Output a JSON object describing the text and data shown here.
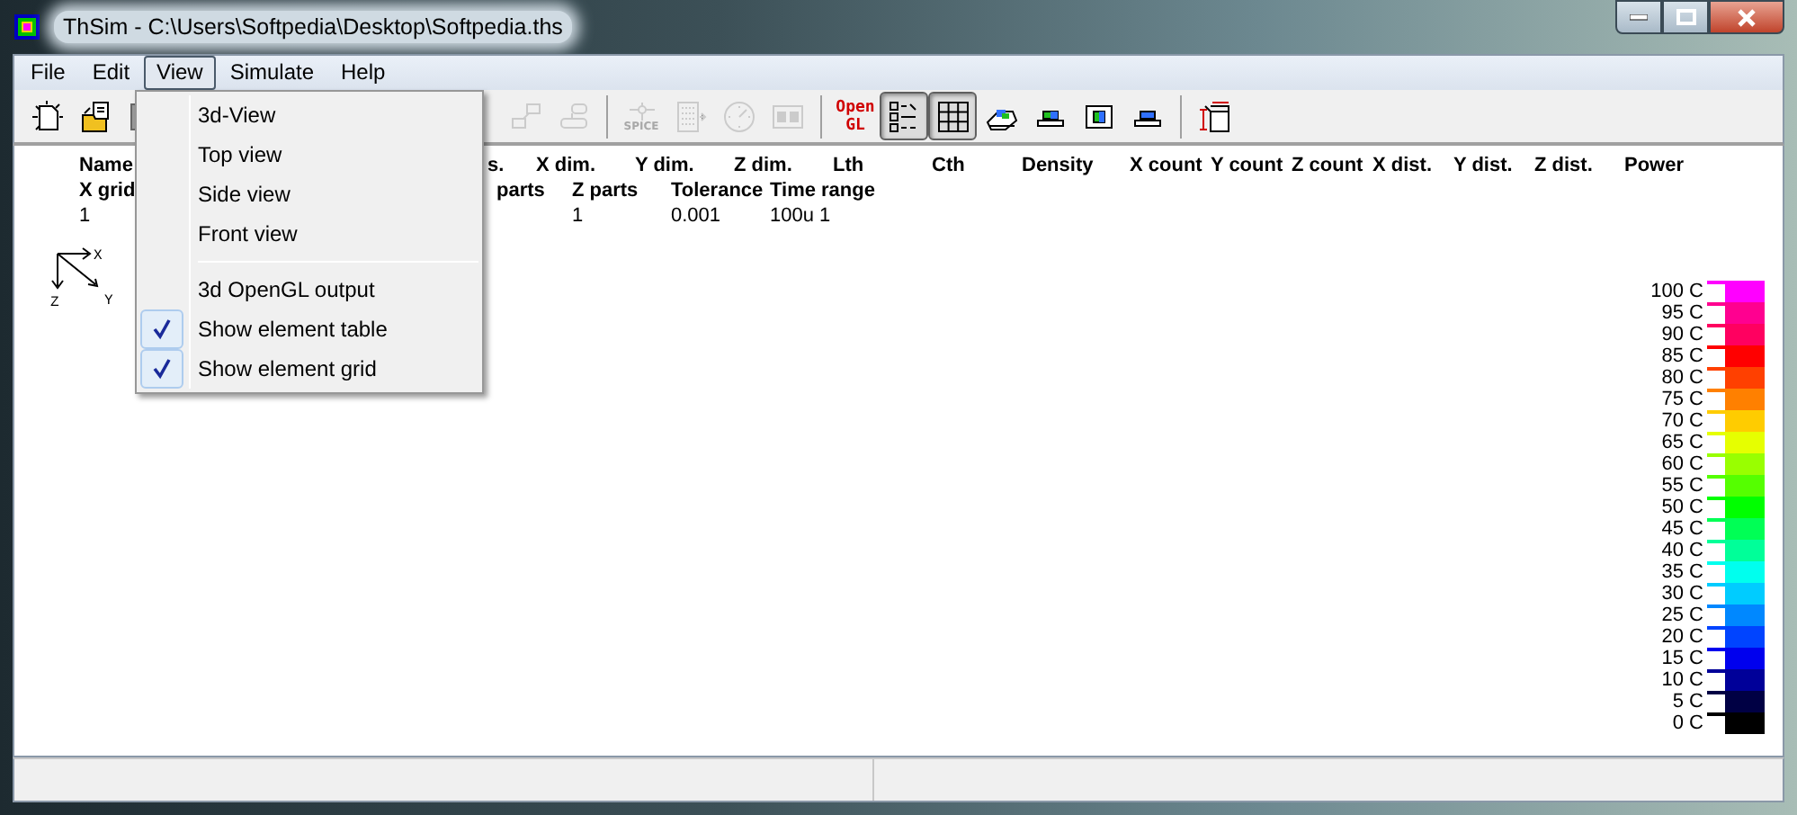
{
  "window": {
    "title": "ThSim - C:\\Users\\Softpedia\\Desktop\\Softpedia.ths"
  },
  "menu_bar": [
    {
      "label": "File",
      "selected": false
    },
    {
      "label": "Edit",
      "selected": false
    },
    {
      "label": "View",
      "selected": true
    },
    {
      "label": "Simulate",
      "selected": false
    },
    {
      "label": "Help",
      "selected": false
    }
  ],
  "toolbar": [
    {
      "kind": "button",
      "pressed": false,
      "disabled": false
    },
    {
      "kind": "button",
      "pressed": false,
      "disabled": false
    },
    {
      "kind": "button",
      "pressed": false,
      "disabled": false
    },
    {
      "kind": "button",
      "pressed": false,
      "disabled": true
    },
    {
      "kind": "button",
      "pressed": false,
      "disabled": true
    },
    {
      "kind": "separator"
    },
    {
      "kind": "button",
      "pressed": false,
      "disabled": true,
      "label": "SPICE"
    },
    {
      "kind": "button",
      "pressed": false,
      "disabled": true
    },
    {
      "kind": "button",
      "pressed": false,
      "disabled": true
    },
    {
      "kind": "button",
      "pressed": false,
      "disabled": true
    },
    {
      "kind": "separator"
    },
    {
      "kind": "text-button",
      "pressed": false,
      "disabled": false,
      "lines": [
        "Open",
        "GL"
      ]
    },
    {
      "kind": "button",
      "pressed": true,
      "disabled": false
    },
    {
      "kind": "button",
      "pressed": true,
      "disabled": false
    },
    {
      "kind": "button",
      "pressed": false,
      "disabled": false
    },
    {
      "kind": "button",
      "pressed": false,
      "disabled": false
    },
    {
      "kind": "button",
      "pressed": false,
      "disabled": false
    },
    {
      "kind": "button",
      "pressed": false,
      "disabled": false
    },
    {
      "kind": "separator"
    },
    {
      "kind": "button",
      "pressed": false,
      "disabled": false
    }
  ],
  "element_table": {
    "rows": [
      {
        "header": true,
        "cells": [
          "Name",
          "s.",
          "X dim.",
          "Y dim.",
          "Z dim.",
          "Lth",
          "Cth",
          "Density",
          "X count",
          "Y count",
          "Z count",
          "X dist.",
          "Y dist.",
          "Z dist.",
          "Power"
        ]
      },
      {
        "header": true,
        "cells": [
          "X grid",
          "parts",
          "Z parts",
          "Tolerance",
          "Time range"
        ]
      },
      {
        "header": false,
        "cells": [
          "1",
          "",
          "1",
          "0.001",
          "100u 1"
        ]
      }
    ]
  },
  "axes": {
    "x": "X",
    "y": "Y",
    "z": "Z"
  },
  "legend": [
    {
      "label": "100 C",
      "color": "#ff00ff"
    },
    {
      "label": "95 C",
      "color": "#ff0090"
    },
    {
      "label": "90 C",
      "color": "#ff0060"
    },
    {
      "label": "85 C",
      "color": "#ff0000"
    },
    {
      "label": "80 C",
      "color": "#ff4000"
    },
    {
      "label": "75 C",
      "color": "#ff8000"
    },
    {
      "label": "70 C",
      "color": "#ffcc00"
    },
    {
      "label": "65 C",
      "color": "#e6ff00"
    },
    {
      "label": "60 C",
      "color": "#99ff00"
    },
    {
      "label": "55 C",
      "color": "#55ff00"
    },
    {
      "label": "50 C",
      "color": "#00ff00"
    },
    {
      "label": "45 C",
      "color": "#00ff55"
    },
    {
      "label": "40 C",
      "color": "#00ff99"
    },
    {
      "label": "35 C",
      "color": "#00ffee"
    },
    {
      "label": "30 C",
      "color": "#00ccff"
    },
    {
      "label": "25 C",
      "color": "#0088ff"
    },
    {
      "label": "20 C",
      "color": "#0044ff"
    },
    {
      "label": "15 C",
      "color": "#0000ee"
    },
    {
      "label": "10 C",
      "color": "#000099"
    },
    {
      "label": "5 C",
      "color": "#000044"
    },
    {
      "label": "0 C",
      "color": "#000000"
    }
  ],
  "view_menu": [
    {
      "kind": "item",
      "label": "3d-View",
      "checked": false
    },
    {
      "kind": "item",
      "label": "Top view",
      "checked": false
    },
    {
      "kind": "item",
      "label": "Side view",
      "checked": false
    },
    {
      "kind": "item",
      "label": "Front view",
      "checked": false
    },
    {
      "kind": "separator"
    },
    {
      "kind": "item",
      "label": "3d OpenGL output",
      "checked": false
    },
    {
      "kind": "item",
      "label": "Show element table",
      "checked": true
    },
    {
      "kind": "item",
      "label": "Show element grid",
      "checked": true
    }
  ]
}
